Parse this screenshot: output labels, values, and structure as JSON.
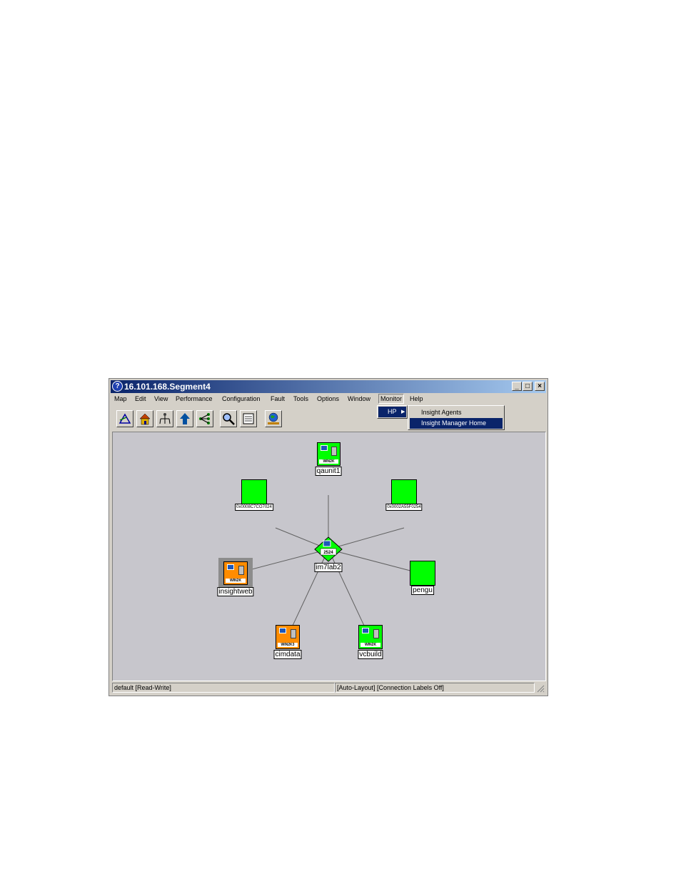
{
  "window": {
    "title": "16.101.168.Segment4"
  },
  "menubar": {
    "items": [
      "Map",
      "Edit",
      "View",
      "Performance",
      "Configuration",
      "Fault",
      "Tools",
      "Options",
      "Window",
      "Monitor",
      "Help"
    ],
    "open_menu": "Monitor"
  },
  "dropdown": {
    "item": "HP"
  },
  "submenu": {
    "items": [
      "Insight Agents",
      "Insight Manager Home"
    ],
    "highlighted": "Insight Manager Home"
  },
  "toolbar": {
    "buttons": [
      "open-map-icon",
      "home-icon",
      "hierarchy-icon",
      "up-arrow-icon",
      "network-tree-icon",
      "find-icon",
      "properties-icon",
      "world-network-icon"
    ]
  },
  "map": {
    "nodes": {
      "hub": {
        "label": "im7lab2",
        "badge": "2524",
        "status_color": "#00ff00"
      },
      "qaunit1": {
        "label": "qaunit1",
        "os": "WIN2K",
        "status_color": "#00ff00"
      },
      "mac_left": {
        "label": "0x0008C7CO7024",
        "status_color": "#00ff00"
      },
      "mac_right": {
        "label": "0x0002A55F0254",
        "status_color": "#00ff00"
      },
      "insightweb": {
        "label": "insightweb",
        "os": "WIN2K",
        "status_color": "#ff8c00"
      },
      "pengu": {
        "label": "pengu",
        "status_color": "#00ff00"
      },
      "cimdata": {
        "label": "cimdata",
        "os": "WIN2K3",
        "status_color": "#ff8c00"
      },
      "vcbuild": {
        "label": "vcbuild",
        "os": "WIN2K",
        "status_color": "#00ff00"
      }
    }
  },
  "statusbar": {
    "left": "default [Read-Write]",
    "right": "[Auto-Layout] [Connection Labels Off]"
  }
}
